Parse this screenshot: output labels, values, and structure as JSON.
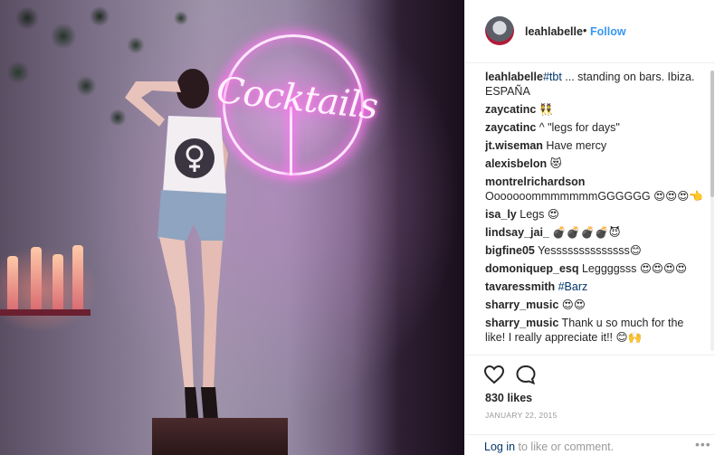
{
  "post": {
    "username": "leahlabelle",
    "separator": "•",
    "follow_label": "Follow",
    "likes": "830 likes",
    "date": "JANUARY 22, 2015",
    "login_link": "Log in",
    "login_rest": " to like or comment.",
    "more_label": "•••"
  },
  "photo": {
    "neon_sign_text": "Cocktails"
  },
  "comments": [
    {
      "user": "leahlabelle",
      "parts": [
        {
          "t": "tag",
          "v": "#tbt"
        },
        {
          "t": "text",
          "v": " ... standing on bars. Ibiza. ESPAÑA"
        }
      ]
    },
    {
      "user": "zaycatinc",
      "parts": [
        {
          "t": "text",
          "v": " 👯"
        }
      ]
    },
    {
      "user": "zaycatinc",
      "parts": [
        {
          "t": "text",
          "v": " ^ \"legs for days\""
        }
      ]
    },
    {
      "user": "jt.wiseman",
      "parts": [
        {
          "t": "text",
          "v": " Have mercy"
        }
      ]
    },
    {
      "user": "alexisbelon",
      "parts": [
        {
          "t": "text",
          "v": " 😻"
        }
      ]
    },
    {
      "user": "montrelrichardson",
      "parts": [
        {
          "t": "text",
          "v": " OoooooommmmmmmGGGGGG 😍😍😍👈"
        }
      ]
    },
    {
      "user": "isa_ly",
      "parts": [
        {
          "t": "text",
          "v": " Legs 😍"
        }
      ]
    },
    {
      "user": "lindsay_jai_",
      "parts": [
        {
          "t": "text",
          "v": " 💣💣💣💣😈"
        }
      ]
    },
    {
      "user": "bigfine05",
      "parts": [
        {
          "t": "text",
          "v": " Yessssssssssssss😊"
        }
      ]
    },
    {
      "user": "domoniquep_esq",
      "parts": [
        {
          "t": "text",
          "v": " Leggggsss 😍😍😍😍"
        }
      ]
    },
    {
      "user": "tavaressmith",
      "parts": [
        {
          "t": "tag",
          "v": " #Barz"
        }
      ]
    },
    {
      "user": "sharry_music",
      "parts": [
        {
          "t": "text",
          "v": " 😍😍"
        }
      ]
    },
    {
      "user": "sharry_music",
      "parts": [
        {
          "t": "text",
          "v": " Thank u so much for the like! I really appreciate it!! 😊🙌"
        }
      ]
    }
  ],
  "icons": {
    "heart": "heart-icon",
    "comment": "comment-bubble-icon",
    "more": "more-options-icon"
  },
  "colors": {
    "follow_blue": "#3897f0",
    "link_navy": "#003569",
    "muted_gray": "#999999",
    "text_dark": "#262626"
  }
}
